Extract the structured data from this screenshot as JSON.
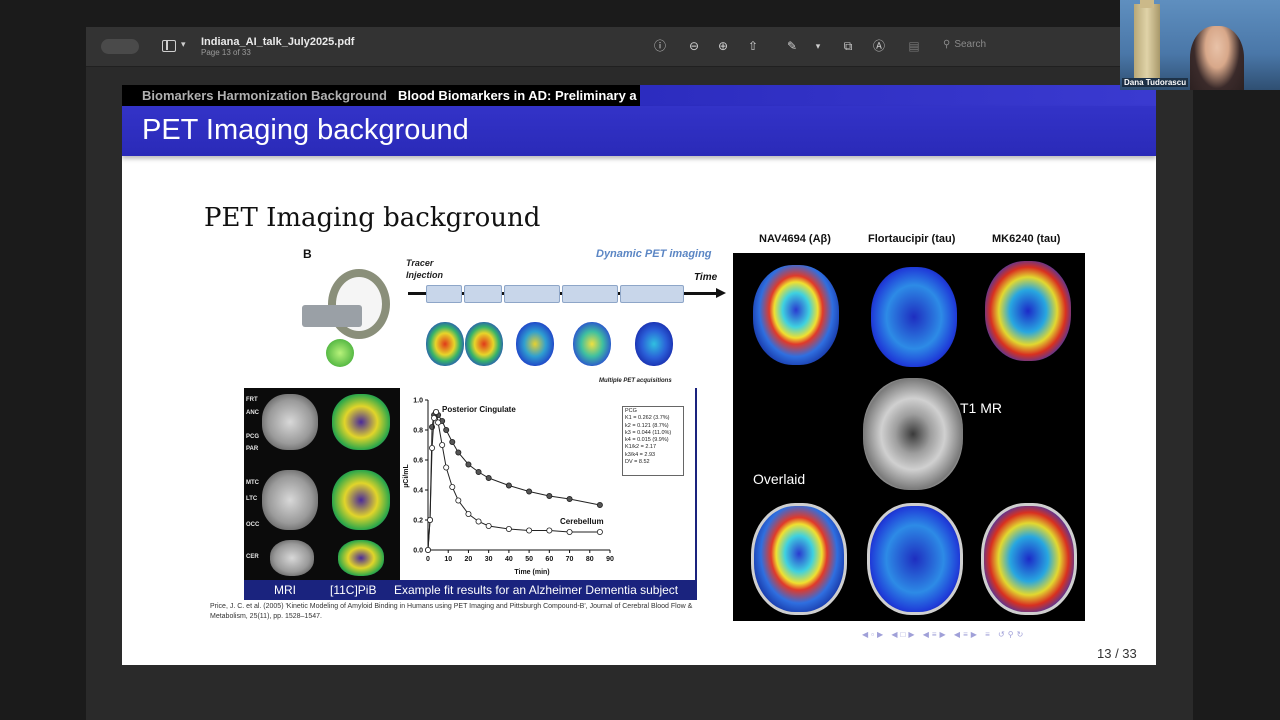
{
  "viewer": {
    "doc_title": "Indiana_AI_talk_July2025.pdf",
    "page_label": "Page 13 of 33",
    "search_placeholder": "Search",
    "icons": [
      "info-icon",
      "zoom-out-icon",
      "zoom-in-icon",
      "share-icon",
      "markup-icon",
      "chevron-down-icon",
      "rotate-icon",
      "annotate-icon",
      "form-icon",
      "search-icon"
    ]
  },
  "slide": {
    "nav_section_1": "Biomarkers Harmonization Background",
    "nav_section_2": "Blood Biomarkers in AD: Preliminary a",
    "title": "PET Imaging background",
    "body_title": "PET Imaging background",
    "fig_b": {
      "label": "B",
      "tracer_injection": "Tracer\nInjection",
      "dynamic_pet": "Dynamic PET imaging",
      "time": "Time",
      "multiple_acq": "Multiple PET acquisitions"
    },
    "fig_c": {
      "regions": [
        "FRT",
        "ANC",
        "PCG",
        "PAR",
        "MTC",
        "LTC",
        "OCC",
        "CER"
      ],
      "caption_mri": "MRI",
      "caption_pib": "[11C]PiB",
      "caption": "Example fit results for an Alzheimer Dementia subject",
      "plot": {
        "label_posterior": "Posterior Cingulate",
        "label_cerebellum": "Cerebellum",
        "xlabel": "Time (min)",
        "ylabel": "µCi/mL"
      },
      "pcg_box": [
        "PCG",
        "K1 = 0.262 (3.7%)",
        "k2 = 0.121 (8.7%)",
        "k3 = 0.044 (11.0%)",
        "k4 = 0.015 (9.9%)",
        "K1/k2 = 2.17",
        "k3/k4 = 2.93",
        "DV = 8.52"
      ]
    },
    "reference": "Price, J. C. et al. (2005) 'Kinetic Modeling of Amyloid Binding in Humans using PET Imaging and Pittsburgh Compound-B', Journal of Cerebral Blood Flow & Metabolism, 25(11), pp. 1528–1547.",
    "right_fig": {
      "headers": [
        "NAV4694 (Aβ)",
        "Flortaucipir (tau)",
        "MK6240 (tau)"
      ],
      "t1_label": "T1 MR",
      "overlaid_label": "Overlaid"
    },
    "page_number": "13 / 33"
  },
  "chart_data": {
    "type": "scatter",
    "xlabel": "Time (min)",
    "ylabel": "µCi/mL",
    "xlim": [
      0,
      90
    ],
    "ylim": [
      0,
      1.0
    ],
    "xticks": [
      0,
      10,
      20,
      30,
      40,
      50,
      60,
      70,
      80,
      90
    ],
    "yticks": [
      0.0,
      0.2,
      0.4,
      0.6,
      0.8,
      1.0
    ],
    "series": [
      {
        "name": "Posterior Cingulate",
        "x": [
          0,
          1,
          2,
          3,
          4,
          5,
          7,
          9,
          12,
          15,
          20,
          25,
          30,
          40,
          50,
          60,
          70,
          85
        ],
        "y": [
          0,
          0.2,
          0.82,
          0.9,
          0.92,
          0.9,
          0.86,
          0.8,
          0.72,
          0.65,
          0.57,
          0.52,
          0.48,
          0.43,
          0.39,
          0.36,
          0.34,
          0.3
        ]
      },
      {
        "name": "Cerebellum",
        "x": [
          0,
          1,
          2,
          3,
          4,
          5,
          7,
          9,
          12,
          15,
          20,
          25,
          30,
          40,
          50,
          60,
          70,
          85
        ],
        "y": [
          0,
          0.2,
          0.68,
          0.88,
          0.92,
          0.85,
          0.7,
          0.55,
          0.42,
          0.33,
          0.24,
          0.19,
          0.16,
          0.14,
          0.13,
          0.13,
          0.12,
          0.12
        ]
      }
    ]
  },
  "participant": {
    "name": "Dana Tudorascu"
  }
}
